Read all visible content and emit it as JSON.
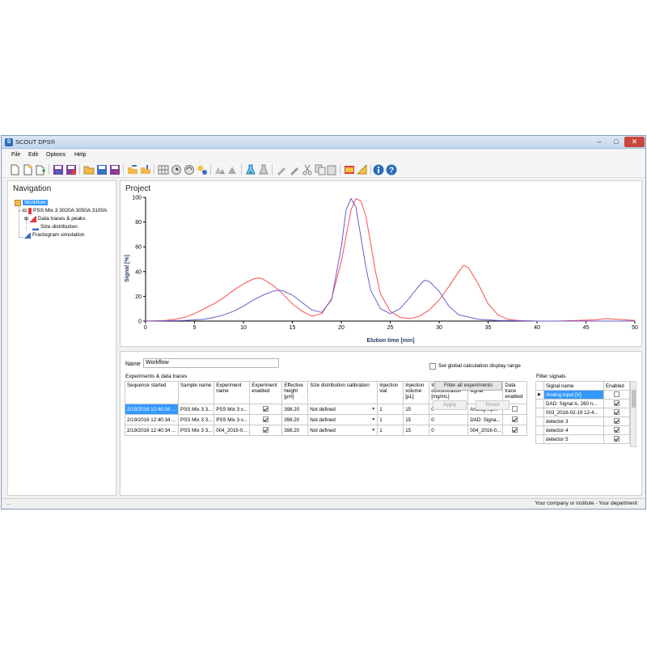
{
  "window": {
    "title": "SCOUT DPS®"
  },
  "menu": {
    "file": "File",
    "edit": "Edit",
    "options": "Options",
    "help": "Help"
  },
  "navigation": {
    "title": "Navigation",
    "workflow": "Workflow",
    "project_node": "PSS Mix 3 3020A 3050A 3100A",
    "data_traces": "Data traces & peaks",
    "size_distribution": "Size distribution",
    "fractogram": "Fractogram simulation"
  },
  "project": {
    "title": "Project"
  },
  "chart_data": {
    "type": "line",
    "xlabel": "Elution time [min]",
    "ylabel": "Signal [%]",
    "xlim": [
      0,
      50
    ],
    "ylim": [
      0,
      100
    ],
    "x_ticks": [
      0,
      5,
      10,
      15,
      20,
      25,
      30,
      35,
      40,
      45,
      50
    ],
    "y_ticks": [
      0,
      20,
      40,
      60,
      80,
      100
    ],
    "grid": false,
    "series": [
      {
        "color": "#ff4d4d",
        "x": [
          0,
          2,
          3,
          4,
          5,
          6,
          7,
          8,
          9,
          10,
          11,
          11.5,
          12,
          13,
          14,
          15,
          16,
          17,
          18,
          19,
          20,
          21,
          21.5,
          22,
          22.5,
          23,
          23.5,
          24,
          25,
          26,
          27,
          28,
          29,
          30,
          31,
          32,
          32.5,
          33,
          34,
          35,
          36,
          37,
          38,
          40,
          42,
          44,
          46,
          47,
          48,
          49,
          50
        ],
        "y": [
          0,
          0.5,
          1.5,
          3,
          6,
          10,
          14,
          19,
          25,
          30,
          34,
          35,
          34,
          29,
          22,
          14,
          8,
          4,
          6,
          18,
          48,
          90,
          99,
          97,
          85,
          63,
          40,
          22,
          8,
          3,
          2,
          4,
          9,
          17,
          28,
          40,
          45,
          43,
          30,
          14,
          5,
          1.5,
          0.5,
          0,
          0,
          0.5,
          1,
          2,
          1.5,
          1,
          0.5
        ]
      },
      {
        "color": "#6a5acd",
        "x": [
          0,
          4,
          6,
          7,
          8,
          9,
          10,
          11,
          12,
          13,
          13.5,
          14,
          15,
          16,
          17,
          18,
          19,
          20,
          20.5,
          21,
          21.5,
          22,
          22.5,
          23,
          24,
          25,
          26,
          27,
          28,
          28.5,
          29,
          30,
          31,
          32,
          34,
          36,
          40,
          45,
          50
        ],
        "y": [
          0,
          0.5,
          1.5,
          3,
          5,
          8,
          12,
          17,
          21,
          24,
          25,
          24.5,
          21,
          15,
          9,
          7,
          17,
          60,
          90,
          99,
          92,
          68,
          44,
          25,
          10,
          6,
          10,
          19,
          29,
          33,
          32,
          24,
          12,
          5,
          1.5,
          0.5,
          0,
          0,
          0
        ]
      }
    ]
  },
  "details": {
    "name_label": "Name",
    "name_value": "Workflow",
    "global_range_label": "Set global calculation display range",
    "experiments_title": "Experiments & data traces",
    "columns": [
      "Sequence started",
      "Sample name",
      "Experiment name",
      "Experiment enabled",
      "Effective height [µm]",
      "Size distribution calibration",
      "Injection vial",
      "Injection volume [µL]",
      "Injection concentration [mg/mL]",
      "Data trace signal",
      "Data trace enabled"
    ],
    "rows": [
      {
        "started": "2/19/2016 12:40:34 ...",
        "sample": "PSS Mix 3 3...",
        "experiment": "PSS Mix 3 v...",
        "height": "398.20",
        "calibration": "Not defined",
        "vial": "1",
        "volume": "15",
        "conc": "0",
        "signal": "Analog inp...",
        "exp_enabled": true,
        "trace_enabled": false
      },
      {
        "started": "2/19/2016 12:40:34 ...",
        "sample": "PSS Mix 3 3...",
        "experiment": "PSS Mix 3 v...",
        "height": "398.20",
        "calibration": "Not defined",
        "vial": "1",
        "volume": "15",
        "conc": "0",
        "signal": "DAD: Signa...",
        "exp_enabled": true,
        "trace_enabled": true
      },
      {
        "started": "2/19/2016 12:40:34 ...",
        "sample": "PSS Mix 3 3...",
        "experiment": "004_2016-0...",
        "height": "398.20",
        "calibration": "Not defined",
        "vial": "1",
        "volume": "15",
        "conc": "0",
        "signal": "004_2016-0...",
        "exp_enabled": true,
        "trace_enabled": true
      }
    ]
  },
  "filter": {
    "title": "Filter signals",
    "col_name": "Signal name",
    "col_enabled": "Enabled",
    "rows": [
      {
        "name": "Analog input [V]",
        "enabled": false
      },
      {
        "name": "DAD: Signal A, 260 n...",
        "enabled": true
      },
      {
        "name": "003_2016-02-19 12-4...",
        "enabled": true
      },
      {
        "name": "detector 3",
        "enabled": true
      },
      {
        "name": "detector 4",
        "enabled": true
      },
      {
        "name": "detector 5",
        "enabled": true
      }
    ],
    "filter_all_label": "Filter all experiments",
    "apply_label": "Apply",
    "reset_label": "Reset"
  },
  "status": {
    "left": "...",
    "right": "Your company or institute - Your department"
  }
}
